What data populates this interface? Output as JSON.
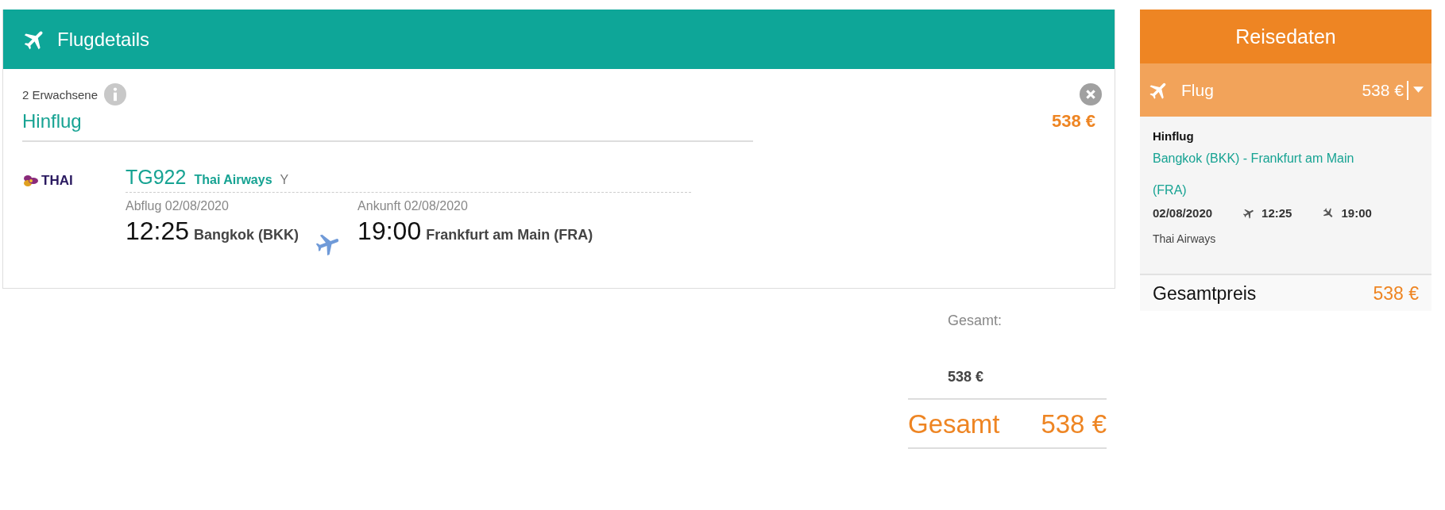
{
  "flight_details": {
    "title": "Flugdetails",
    "passengers": "2 Erwachsene",
    "leg": {
      "title": "Hinflug",
      "price": "538 €"
    },
    "flight": {
      "logo_text": "THAI",
      "number": "TG922",
      "airline": "Thai Airways",
      "cabin_class": "Y",
      "departure": {
        "label": "Abflug 02/08/2020",
        "time": "12:25",
        "place": "Bangkok (BKK)"
      },
      "arrival": {
        "label": "Ankunft 02/08/2020",
        "time": "19:00",
        "place": "Frankfurt am Main (FRA)"
      }
    }
  },
  "totals": {
    "label": "Gesamt:",
    "amount": "538 €",
    "grand_label": "Gesamt",
    "grand_amount": "538 €"
  },
  "sidebar": {
    "title": "Reisedaten",
    "section": {
      "label": "Flug",
      "price": "538 €"
    },
    "details": {
      "title": "Hinflug",
      "route": "Bangkok (BKK) - Frankfurt am Main (FRA)",
      "date": "02/08/2020",
      "departure_time": "12:25",
      "arrival_time": "19:00",
      "airline": "Thai Airways"
    },
    "total_label": "Gesamtpreis",
    "total": "538 €"
  }
}
